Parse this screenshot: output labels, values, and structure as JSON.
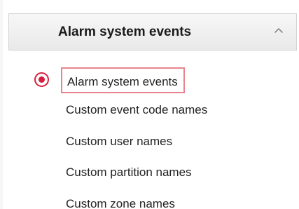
{
  "panel": {
    "header_title": "Alarm system events",
    "collapse_icon": "chevron-up-icon"
  },
  "nav": {
    "selected_indicator_icon": "radio-selected-icon",
    "accent_color": "#d61f3f",
    "selection_border_color": "#e8848e",
    "items": [
      {
        "label": "Alarm system events",
        "selected": true
      },
      {
        "label": "Custom event code names",
        "selected": false
      },
      {
        "label": "Custom user names",
        "selected": false
      },
      {
        "label": "Custom partition names",
        "selected": false
      },
      {
        "label": "Custom zone names",
        "selected": false
      }
    ]
  }
}
